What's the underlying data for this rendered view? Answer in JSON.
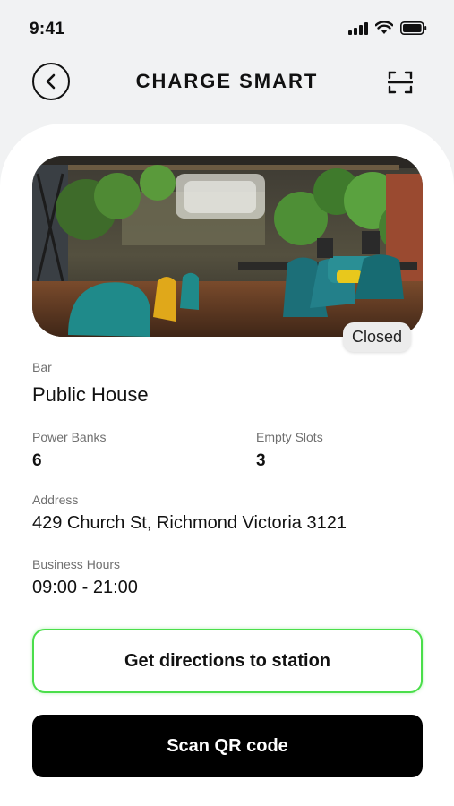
{
  "status_bar": {
    "time": "9:41",
    "icons": [
      "signal-icon",
      "wifi-icon",
      "battery-icon"
    ]
  },
  "header": {
    "title": "CHARGE SMART",
    "back_icon": "chevron-left-icon",
    "scan_icon": "scan-frame-icon"
  },
  "station": {
    "status": "Closed",
    "category_label": "Bar",
    "name": "Public House",
    "power_banks_label": "Power Banks",
    "power_banks_value": "6",
    "empty_slots_label": "Empty Slots",
    "empty_slots_value": "3",
    "address_label": "Address",
    "address_value": "429 Church St, Richmond Victoria 3121",
    "hours_label": "Business Hours",
    "hours_value": "09:00 - 21:00"
  },
  "actions": {
    "directions_label": "Get directions to station",
    "scan_label": "Scan QR code"
  },
  "colors": {
    "accent_green": "#4ade4a",
    "primary_button": "#000000",
    "background": "#f1f2f3"
  }
}
